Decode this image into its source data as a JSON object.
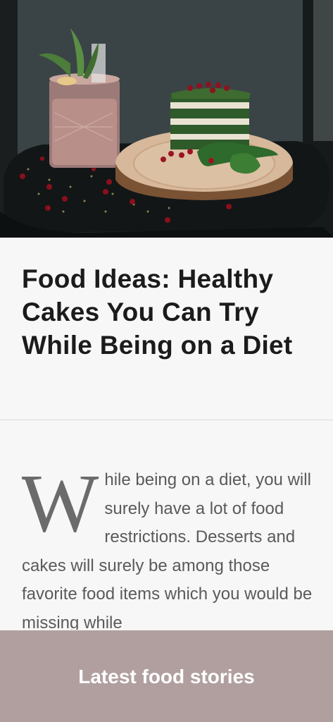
{
  "article": {
    "title": "Food Ideas: Healthy Cakes You Can Try While Being on a Diet",
    "dropcap": "W",
    "body": "hile being on a diet, you will surely have a lot of food restrictions. Desserts and cakes will surely be among those favorite food items which you would be missing while"
  },
  "footer": {
    "label": "Latest food stories"
  },
  "colors": {
    "footer_bg": "#b19f9f",
    "page_bg": "#f7f7f7",
    "title": "#1b1b1b",
    "body_text": "#5a5a5a"
  }
}
